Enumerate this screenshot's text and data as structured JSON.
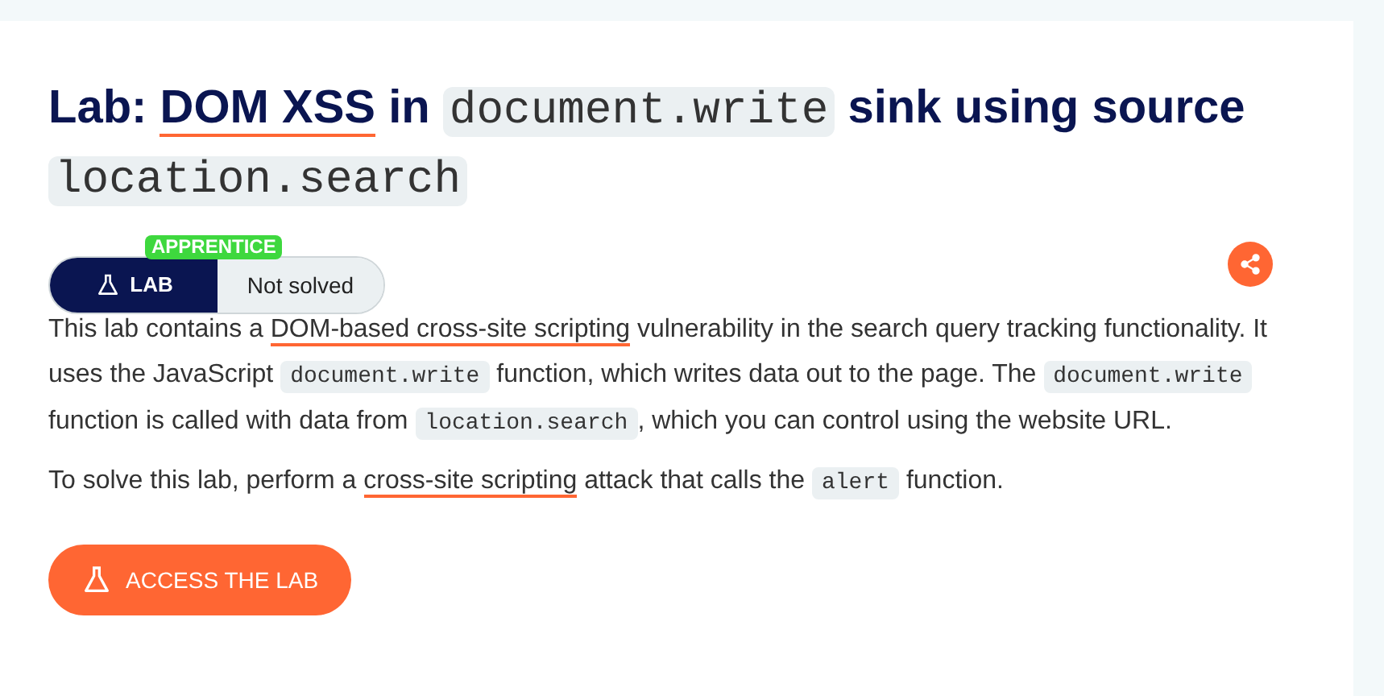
{
  "title": [
    {
      "kind": "text",
      "text": "Lab: "
    },
    {
      "kind": "link",
      "text": "DOM XSS"
    },
    {
      "kind": "text",
      "text": " in "
    },
    {
      "kind": "code",
      "text": "document.write"
    },
    {
      "kind": "text",
      "text": " sink using source "
    },
    {
      "kind": "code",
      "text": "location.search"
    }
  ],
  "level_badge": "APPRENTICE",
  "lab_tag": "LAB",
  "status": "Not solved",
  "paragraphs": [
    [
      {
        "kind": "text",
        "text": "This lab contains a "
      },
      {
        "kind": "link",
        "text": "DOM-based cross-site scripting"
      },
      {
        "kind": "text",
        "text": " vulnerability in the search query tracking functionality. It uses the JavaScript "
      },
      {
        "kind": "code",
        "text": "document.write"
      },
      {
        "kind": "text",
        "text": " function, which writes data out to the page. The "
      },
      {
        "kind": "code",
        "text": "document.write"
      },
      {
        "kind": "text",
        "text": " function is called with data from "
      },
      {
        "kind": "code",
        "text": "location.search"
      },
      {
        "kind": "text",
        "text": ", which you can control using the website URL."
      }
    ],
    [
      {
        "kind": "text",
        "text": "To solve this lab, perform a "
      },
      {
        "kind": "link",
        "text": "cross-site scripting"
      },
      {
        "kind": "text",
        "text": " attack that calls the "
      },
      {
        "kind": "code",
        "text": "alert"
      },
      {
        "kind": "text",
        "text": " function."
      }
    ]
  ],
  "access_button": "ACCESS THE LAB"
}
